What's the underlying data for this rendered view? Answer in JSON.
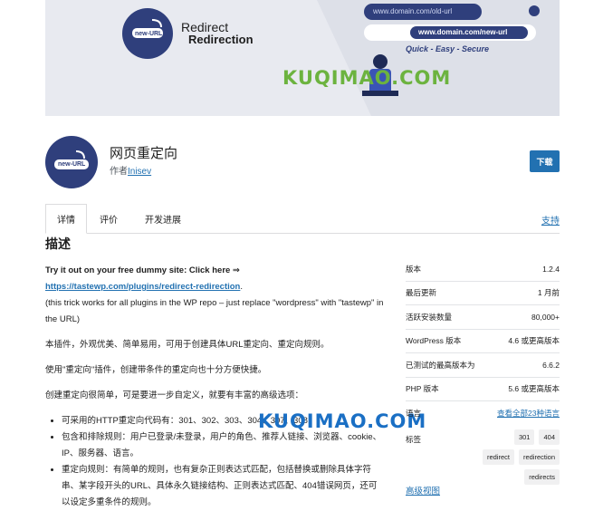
{
  "banner": {
    "logo_text": "new-URL",
    "title_line1": "Redirect",
    "title_line2": "Redirection",
    "old_url": "www.domain.com/old-url",
    "new_url": "www.domain.com/new-url",
    "tagline": "Quick - Easy - Secure",
    "watermark": "KUQIMAO.COM"
  },
  "header": {
    "title": "网页重定向",
    "author_prefix": "作者",
    "author_name": "Inisev",
    "download_label": "下载",
    "icon_text": "new-URL"
  },
  "tabs": [
    {
      "label": "详情"
    },
    {
      "label": "评价"
    },
    {
      "label": "开发进展"
    }
  ],
  "support_label": "支持",
  "description": {
    "heading": "描述",
    "try_line": "Try it out on your free dummy site: Click here ⇒",
    "try_link": "https://tastewp.com/plugins/redirect-redirection",
    "try_link_suffix": ".",
    "trick_note": "(this trick works for all plugins in the WP repo – just replace \"wordpress\" with \"tastewp\" in the URL)",
    "para1": "本插件，外观优美、简单易用，可用于创建具体URL重定向、重定向规则。",
    "para2": "使用\"重定向\"插件，创建带条件的重定向也十分方便快捷。",
    "para3": "创建重定向很简单，可是要进一步自定义，就要有丰富的高级选项：",
    "bullets": [
      "可采用的HTTP重定向代码有：301、302、303、304、307、308；",
      "包含和排除规则：用户已登录/未登录，用户的角色、推荐人链接、浏览器、cookie、IP、服务器、语言。",
      "重定向规则：有简单的规则，也有复杂正则表达式匹配，包括替换或删除具体字符串、某字段开头的URL、具体永久链接结构、正则表达式匹配、404错误网页，还可以设定多重条件的规则。"
    ],
    "watermark": "KUQIMAO.COM"
  },
  "meta": [
    {
      "label": "版本",
      "value": "1.2.4"
    },
    {
      "label": "最后更新",
      "value": "1 月前"
    },
    {
      "label": "活跃安装数量",
      "value": "80,000+"
    },
    {
      "label": "WordPress 版本",
      "value": "4.6 或更高版本"
    },
    {
      "label": "已测试的最高版本为",
      "value": "6.6.2"
    },
    {
      "label": "PHP 版本",
      "value": "5.6 或更高版本"
    },
    {
      "label": "语言",
      "value": "查看全部23种语言"
    }
  ],
  "tags_label": "标签",
  "tags": [
    "301",
    "404",
    "redirect",
    "redirection",
    "redirects"
  ],
  "advanced_view": "高级视图",
  "colors": {
    "accent": "#2271b1",
    "icon_bg": "#2f3f7c"
  }
}
